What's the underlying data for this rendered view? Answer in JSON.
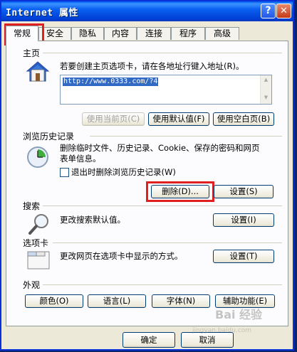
{
  "window": {
    "title": "Internet 属性",
    "help_btn": "?",
    "close_btn": "✕"
  },
  "tabs": [
    "常规",
    "安全",
    "隐私",
    "内容",
    "连接",
    "程序",
    "高级"
  ],
  "home": {
    "section": "主页",
    "desc": "若要创建主页选项卡，请在各地址行键入地址(R)。",
    "url": "http://www.0333.com/?4",
    "btn_current": "使用当前页(C)",
    "btn_default": "使用默认值(F)",
    "btn_blank": "使用空白页(B)"
  },
  "history": {
    "section": "浏览历史记录",
    "desc_line1": "删除临时文件、历史记录、Cookie、保存的密码和网页",
    "desc_line2": "表单信息。",
    "checkbox_label": "退出时删除浏览历史记录(W)",
    "btn_delete": "删除(D)...",
    "btn_settings": "设置(S)"
  },
  "search": {
    "section": "搜索",
    "desc": "更改搜索默认值。",
    "btn_settings": "设置(I)"
  },
  "tabbed": {
    "section": "选项卡",
    "desc": "更改网页在选项卡中显示的方式。",
    "btn_settings": "设置(T)"
  },
  "appearance": {
    "section": "外观",
    "btn_colors": "颜色(O)",
    "btn_languages": "语言(L)",
    "btn_fonts": "字体(N)",
    "btn_accessibility": "辅助功能(E)"
  },
  "footer": {
    "btn_ok": "确定",
    "btn_cancel": "取消"
  },
  "watermark": {
    "text": "Bai 经验",
    "sub": "jingyan.baidu.com"
  }
}
